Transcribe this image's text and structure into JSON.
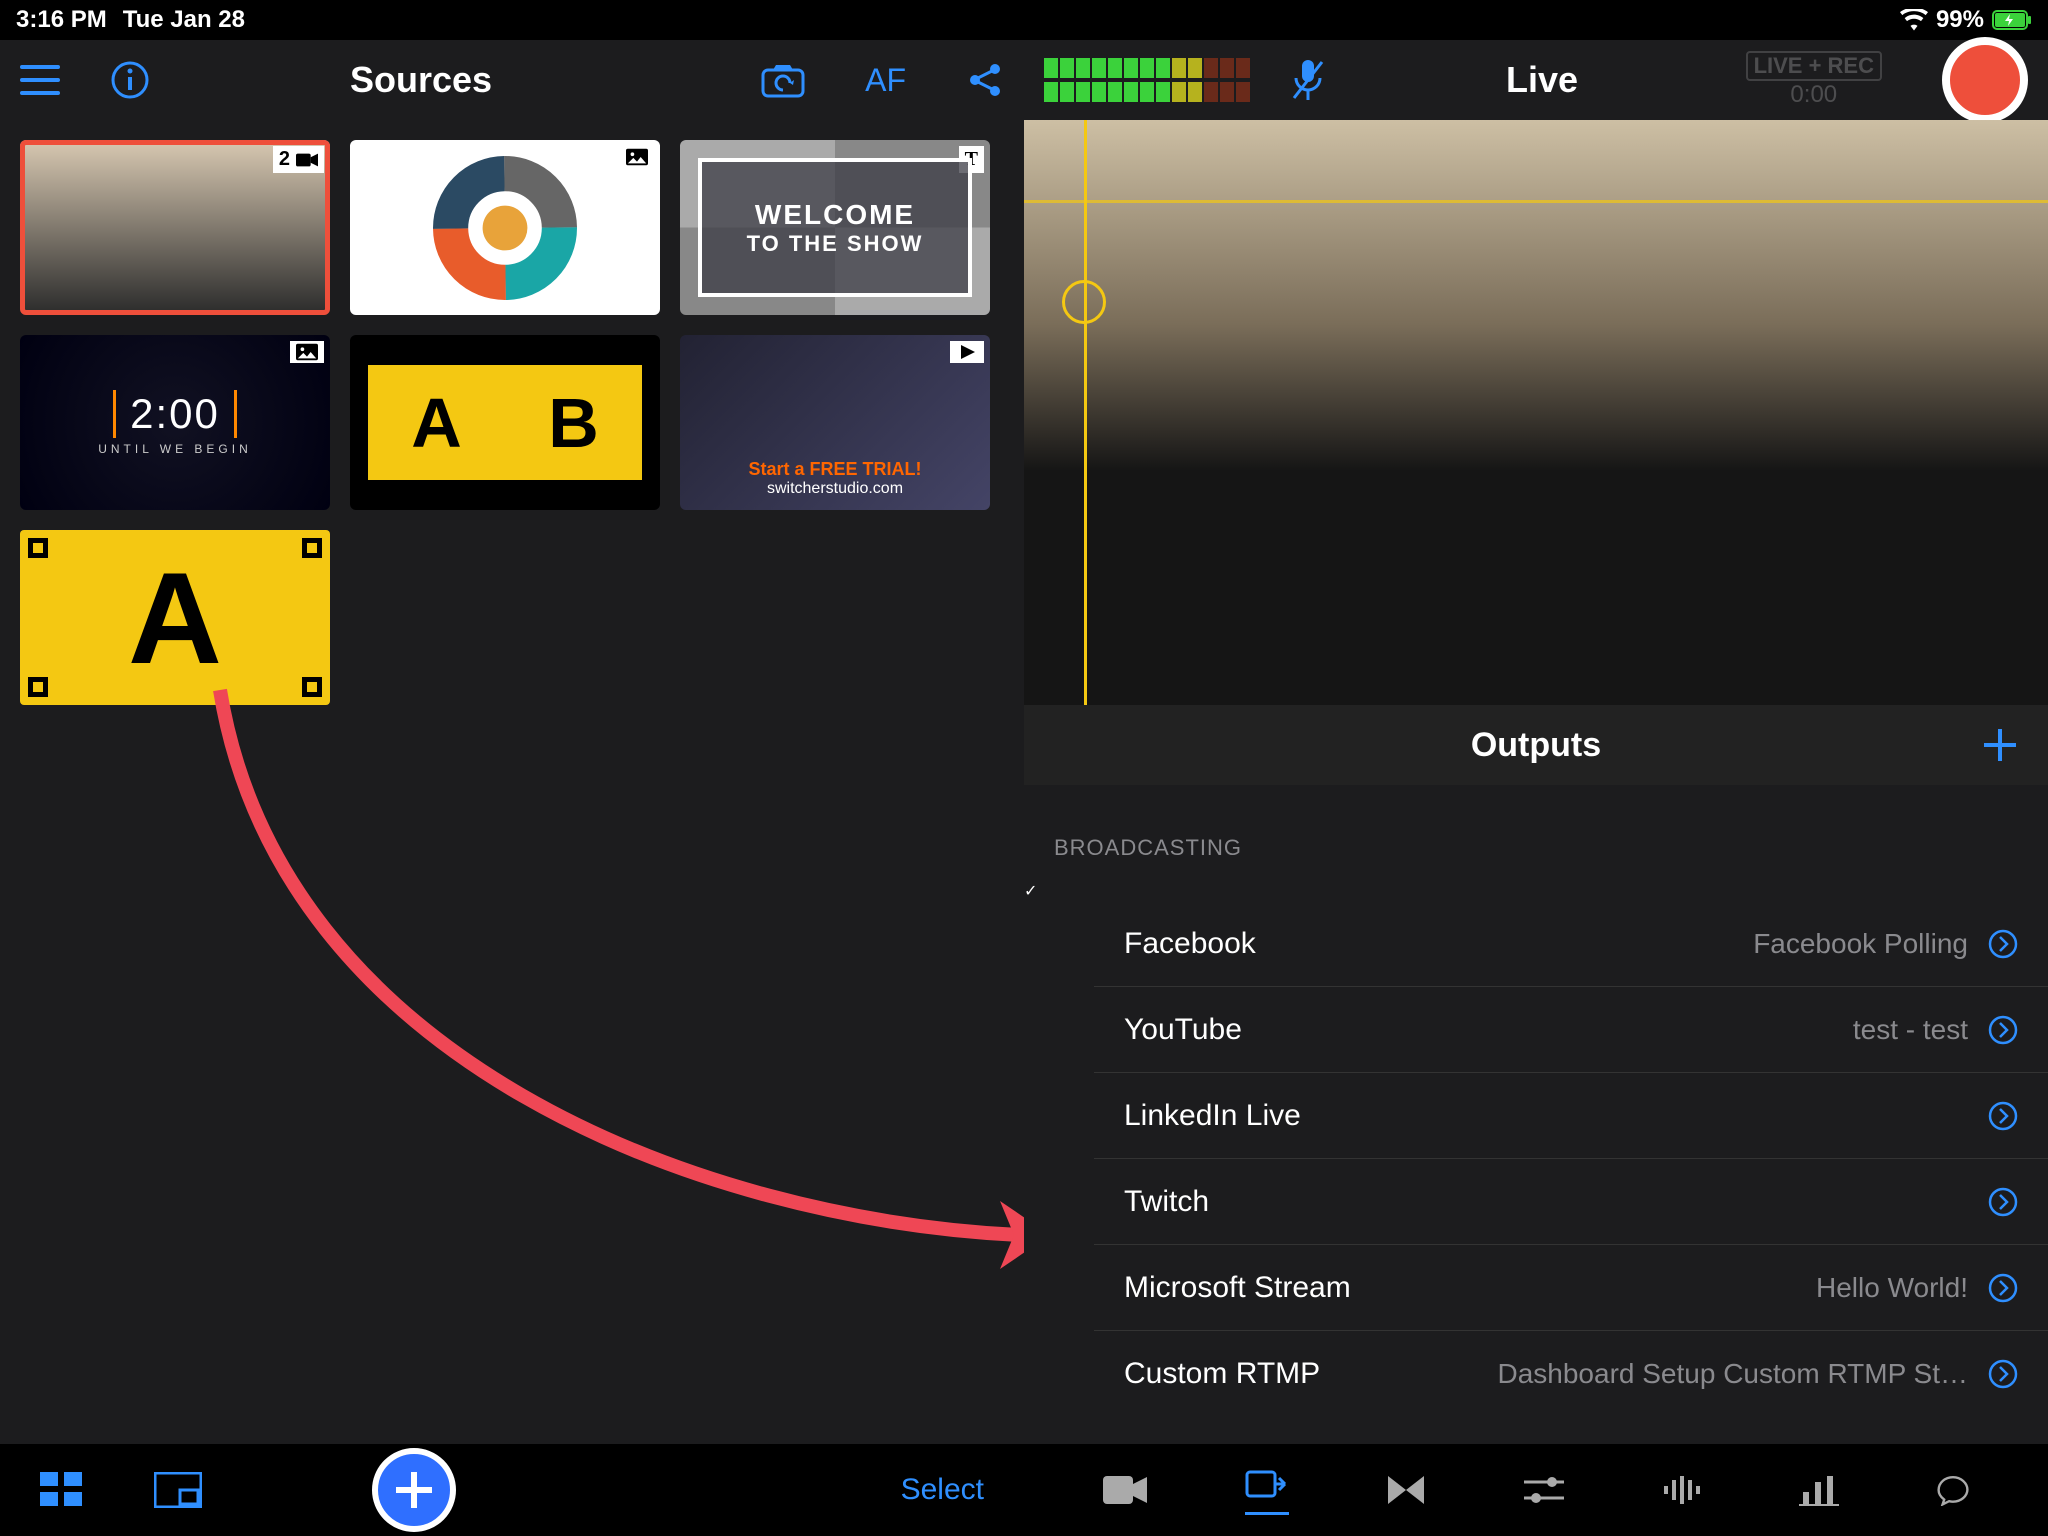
{
  "status": {
    "time": "3:16 PM",
    "date": "Tue Jan 28",
    "battery": "99%"
  },
  "left": {
    "title": "Sources",
    "af_label": "AF",
    "select_label": "Select",
    "tiles": {
      "cam_badge": "2",
      "welcome_l1": "WELCOME",
      "welcome_l2": "TO THE SHOW",
      "timer_value": "2:00",
      "timer_sub": "UNTIL WE BEGIN",
      "ab_a": "A",
      "ab_b": "B",
      "promo_l1": "Start a FREE TRIAL!",
      "promo_l2": "switcherstudio.com",
      "big_a": "A"
    }
  },
  "right": {
    "title": "Live",
    "liverec_label": "LIVE + REC",
    "liverec_time": "0:00",
    "outputs_title": "Outputs",
    "section_label": "BROADCASTING",
    "outputs": [
      {
        "name": "Facebook",
        "detail": "Facebook Polling",
        "checked": true
      },
      {
        "name": "YouTube",
        "detail": "test - test",
        "checked": false
      },
      {
        "name": "LinkedIn Live",
        "detail": "",
        "checked": false
      },
      {
        "name": "Twitch",
        "detail": "",
        "checked": false
      },
      {
        "name": "Microsoft Stream",
        "detail": "Hello World!",
        "checked": false
      },
      {
        "name": "Custom RTMP",
        "detail": "Dashboard Setup Custom RTMP St…",
        "checked": false
      }
    ]
  },
  "colors": {
    "accent": "#2f8fff",
    "record": "#ee4f3b",
    "yellow": "#f4c812"
  }
}
